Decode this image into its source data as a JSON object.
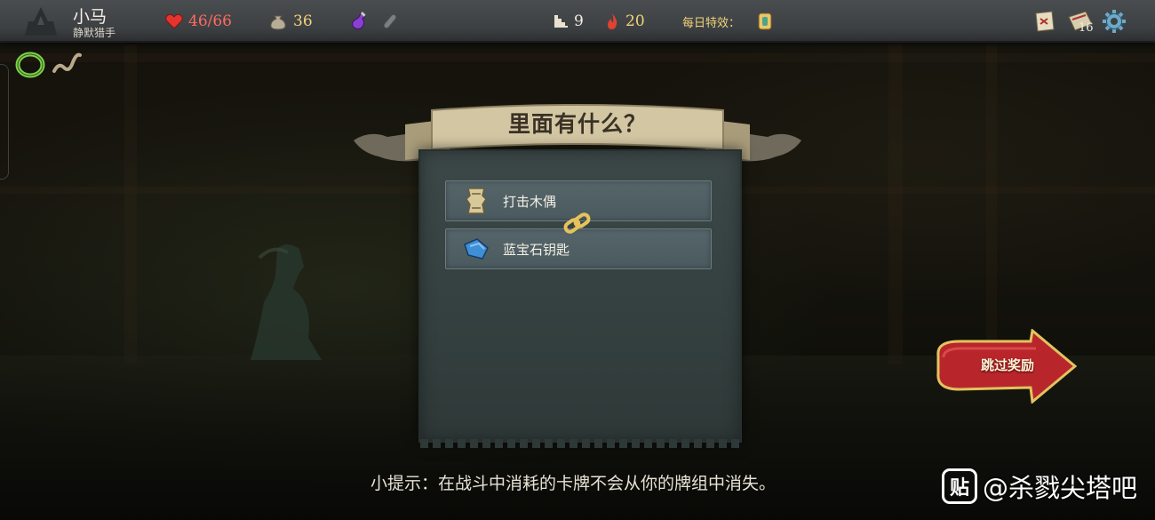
{
  "player": {
    "name": "小马",
    "class_title": "静默猎手"
  },
  "stats": {
    "hp": "46/66",
    "gold": "36",
    "floor": "9",
    "ascension": "20",
    "deck_count": "16"
  },
  "daily_mods_label": "每日特效：",
  "event": {
    "title": "里面有什么？",
    "rewards": [
      {
        "label": "打击木偶",
        "icon": "relic-scroll-icon"
      },
      {
        "label": "蓝宝石钥匙",
        "icon": "sapphire-key-icon"
      }
    ]
  },
  "skip_button_label": "跳过奖励",
  "tip": "小提示：在战斗中消耗的卡牌不会从你的牌组中消失。",
  "watermark": {
    "icon_glyph": "贴",
    "text": "@杀戮尖塔吧"
  },
  "colors": {
    "hp": "#ff6a5f",
    "gold": "#f2d27a",
    "panel": "#34403f",
    "skip_button": "#b8262c"
  }
}
